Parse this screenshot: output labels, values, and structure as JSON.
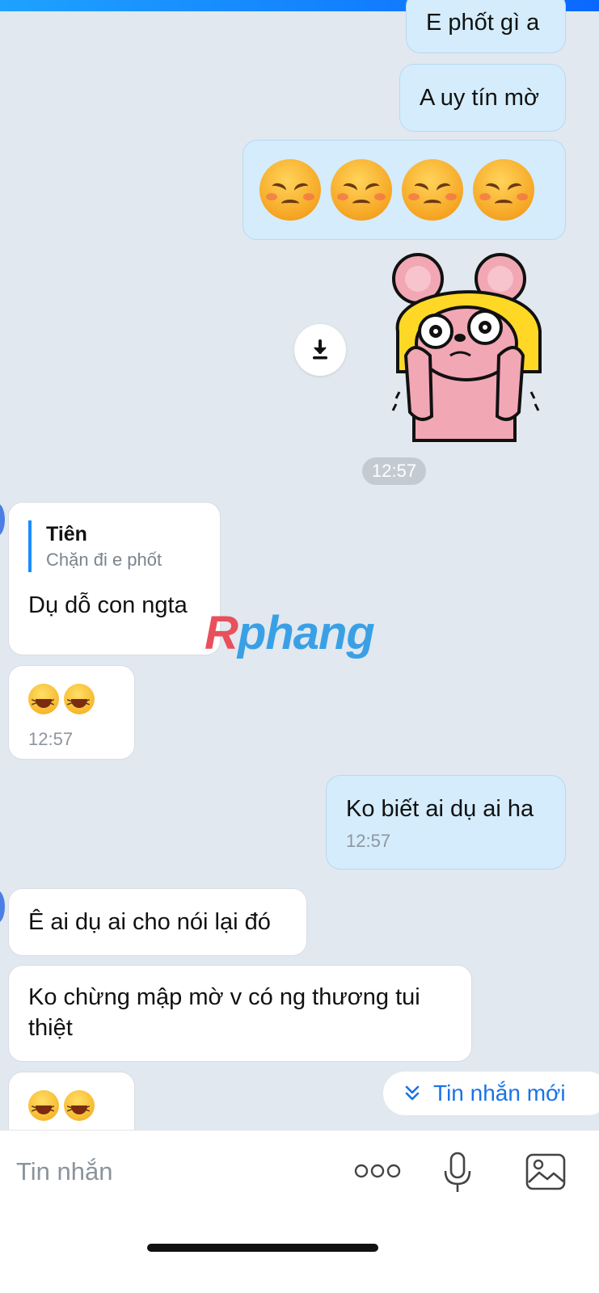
{
  "messages": {
    "m1": {
      "text": "E phốt gì a"
    },
    "m2": {
      "text": "A uy tín mờ"
    },
    "m3_emoji_count": 4,
    "sticker_time": "12:57",
    "m4": {
      "quote_name": "Tiên",
      "quote_text": "Chặn đi e phốt",
      "text": "Dụ dỗ con ngta"
    },
    "m5": {
      "time": "12:57"
    },
    "m6": {
      "text": "Ko biết ai dụ ai ha",
      "time": "12:57"
    },
    "m7": {
      "text": "Ê ai dụ ai cho nói lại đó"
    },
    "m8": {
      "text": "Ko chừng mập mờ v có ng thương tui thiệt"
    }
  },
  "watermark": {
    "part1": "R",
    "part2": "phang"
  },
  "new_message_pill": {
    "label": "Tin nhắn mới",
    "icon": "double-chevron-down-icon"
  },
  "composer": {
    "placeholder": "Tin nhắn",
    "icons": [
      "more-dots-icon",
      "microphone-icon",
      "image-icon"
    ]
  },
  "colors": {
    "background": "#e2e8ef",
    "my_bubble": "#d4ecfb",
    "their_bubble": "#ffffff",
    "accent": "#1a73e8"
  }
}
